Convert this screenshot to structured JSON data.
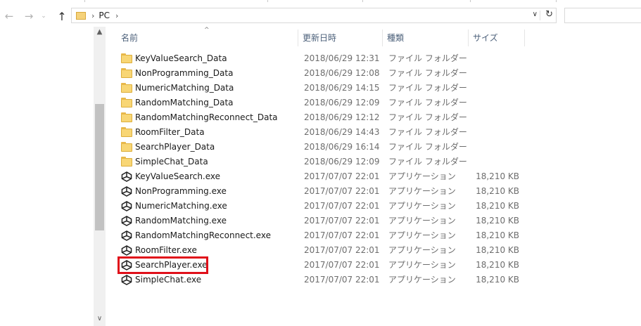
{
  "nav": {
    "breadcrumb": "PC"
  },
  "columns": {
    "name": "名前",
    "date": "更新日時",
    "type": "種類",
    "size": "サイズ"
  },
  "files": [
    {
      "name": "KeyValueSearch_Data",
      "date": "2018/06/29 12:31",
      "type": "ファイル フォルダー",
      "size": "",
      "kind": "folder"
    },
    {
      "name": "NonProgramming_Data",
      "date": "2018/06/29 12:08",
      "type": "ファイル フォルダー",
      "size": "",
      "kind": "folder"
    },
    {
      "name": "NumericMatching_Data",
      "date": "2018/06/29 14:15",
      "type": "ファイル フォルダー",
      "size": "",
      "kind": "folder"
    },
    {
      "name": "RandomMatching_Data",
      "date": "2018/06/29 12:09",
      "type": "ファイル フォルダー",
      "size": "",
      "kind": "folder"
    },
    {
      "name": "RandomMatchingReconnect_Data",
      "date": "2018/06/29 12:12",
      "type": "ファイル フォルダー",
      "size": "",
      "kind": "folder"
    },
    {
      "name": "RoomFilter_Data",
      "date": "2018/06/29 14:43",
      "type": "ファイル フォルダー",
      "size": "",
      "kind": "folder"
    },
    {
      "name": "SearchPlayer_Data",
      "date": "2018/06/29 16:14",
      "type": "ファイル フォルダー",
      "size": "",
      "kind": "folder"
    },
    {
      "name": "SimpleChat_Data",
      "date": "2018/06/29 12:09",
      "type": "ファイル フォルダー",
      "size": "",
      "kind": "folder"
    },
    {
      "name": "KeyValueSearch.exe",
      "date": "2017/07/07 22:01",
      "type": "アプリケーション",
      "size": "18,210 KB",
      "kind": "exe"
    },
    {
      "name": "NonProgramming.exe",
      "date": "2017/07/07 22:01",
      "type": "アプリケーション",
      "size": "18,210 KB",
      "kind": "exe"
    },
    {
      "name": "NumericMatching.exe",
      "date": "2017/07/07 22:01",
      "type": "アプリケーション",
      "size": "18,210 KB",
      "kind": "exe"
    },
    {
      "name": "RandomMatching.exe",
      "date": "2017/07/07 22:01",
      "type": "アプリケーション",
      "size": "18,210 KB",
      "kind": "exe"
    },
    {
      "name": "RandomMatchingReconnect.exe",
      "date": "2017/07/07 22:01",
      "type": "アプリケーション",
      "size": "18,210 KB",
      "kind": "exe"
    },
    {
      "name": "RoomFilter.exe",
      "date": "2017/07/07 22:01",
      "type": "アプリケーション",
      "size": "18,210 KB",
      "kind": "exe"
    },
    {
      "name": "SearchPlayer.exe",
      "date": "2017/07/07 22:01",
      "type": "アプリケーション",
      "size": "18,210 KB",
      "kind": "exe"
    },
    {
      "name": "SimpleChat.exe",
      "date": "2017/07/07 22:01",
      "type": "アプリケーション",
      "size": "18,210 KB",
      "kind": "exe"
    }
  ],
  "icons": {
    "folder": "folder-icon",
    "exe": "unity-app-icon"
  },
  "colors": {
    "highlight": "#e0101a",
    "folder": "#f8d675",
    "header_text": "#4c607a"
  }
}
